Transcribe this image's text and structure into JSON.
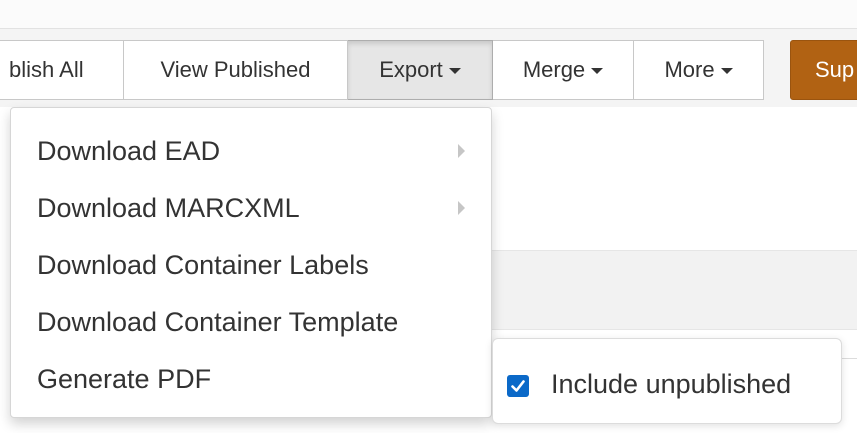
{
  "toolbar": {
    "publish_all_label": "blish All",
    "view_published_label": "View Published",
    "export_label": "Export",
    "merge_label": "Merge",
    "more_label": "More",
    "support_label": "Sup"
  },
  "export_menu": {
    "items": [
      {
        "label": "Download EAD",
        "has_submenu": true
      },
      {
        "label": "Download MARCXML",
        "has_submenu": true
      },
      {
        "label": "Download Container Labels",
        "has_submenu": false
      },
      {
        "label": "Download Container Template",
        "has_submenu": false
      },
      {
        "label": "Generate PDF",
        "has_submenu": false
      }
    ]
  },
  "include_unpublished": {
    "label": "Include unpublished",
    "checked": true
  },
  "colors": {
    "support_button": "#b16213",
    "checkbox": "#0b69c8"
  },
  "icons": {
    "caret": "caret-down-icon",
    "submenu": "chevron-right-icon",
    "check": "checkmark-icon"
  }
}
